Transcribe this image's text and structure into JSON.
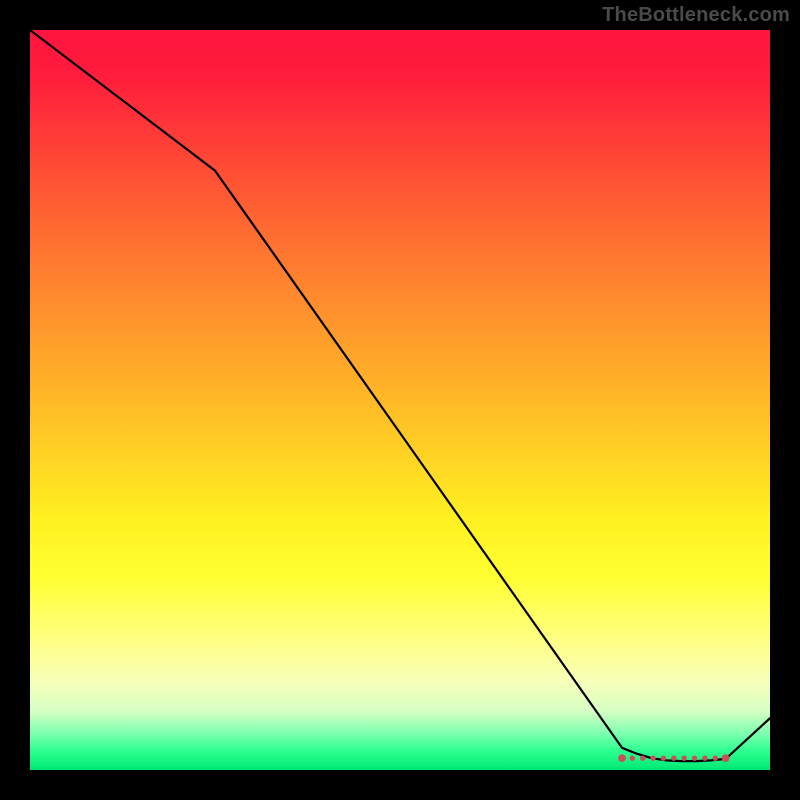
{
  "watermark": "TheBottleneck.com",
  "chart_data": {
    "type": "line",
    "title": "",
    "xlabel": "",
    "ylabel": "",
    "xlim": [
      0,
      100
    ],
    "ylim": [
      0,
      100
    ],
    "x": [
      0,
      25,
      80,
      82,
      84,
      86,
      88,
      90,
      92,
      94,
      100
    ],
    "values": [
      100,
      81,
      3,
      2.2,
      1.6,
      1.3,
      1.2,
      1.2,
      1.3,
      1.5,
      7
    ],
    "optimal_band": {
      "x_start": 80,
      "x_end": 94,
      "y": 1.6
    },
    "annotations": []
  },
  "colors": {
    "gradient_top": "#ff143e",
    "gradient_mid_orange": "#ff8a2e",
    "gradient_mid_yellow": "#fff020",
    "gradient_bottom": "#00e874",
    "line": "#000000",
    "marker": "#cc4f59",
    "frame": "#000000",
    "watermark": "#4a4a4a"
  }
}
